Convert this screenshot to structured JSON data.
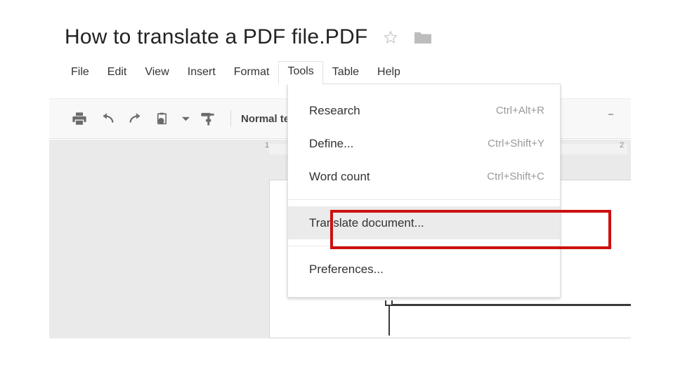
{
  "document": {
    "title": "How to translate a PDF file.PDF",
    "star_icon": "star-outline-icon",
    "folder_icon": "folder-icon"
  },
  "menubar": {
    "items": [
      {
        "label": "File",
        "active": false
      },
      {
        "label": "Edit",
        "active": false
      },
      {
        "label": "View",
        "active": false
      },
      {
        "label": "Insert",
        "active": false
      },
      {
        "label": "Format",
        "active": false
      },
      {
        "label": "Tools",
        "active": true
      },
      {
        "label": "Table",
        "active": false
      },
      {
        "label": "Help",
        "active": false
      }
    ]
  },
  "toolbar": {
    "buttons": [
      {
        "icon": "print-icon"
      },
      {
        "icon": "undo-icon"
      },
      {
        "icon": "redo-icon"
      },
      {
        "icon": "spelling-paste-icon"
      },
      {
        "icon": "chevron-down-icon"
      },
      {
        "icon": "paint-format-icon"
      }
    ],
    "style_label": "Normal text"
  },
  "ruler": {
    "left_number": "1",
    "right_number": "2"
  },
  "tools_menu": {
    "items": [
      {
        "label": "Research",
        "shortcut": "Ctrl+Alt+R",
        "highlighted": false,
        "separator_after": false
      },
      {
        "label": "Define...",
        "shortcut": "Ctrl+Shift+Y",
        "highlighted": false,
        "separator_after": false
      },
      {
        "label": "Word count",
        "shortcut": "Ctrl+Shift+C",
        "highlighted": false,
        "separator_after": true
      },
      {
        "label": "Translate document...",
        "shortcut": "",
        "highlighted": true,
        "separator_after": true
      },
      {
        "label": "Preferences...",
        "shortcut": "",
        "highlighted": false,
        "separator_after": false
      }
    ]
  },
  "annotation": {
    "highlight_color": "#cc1010",
    "target_label": "Translate document..."
  }
}
